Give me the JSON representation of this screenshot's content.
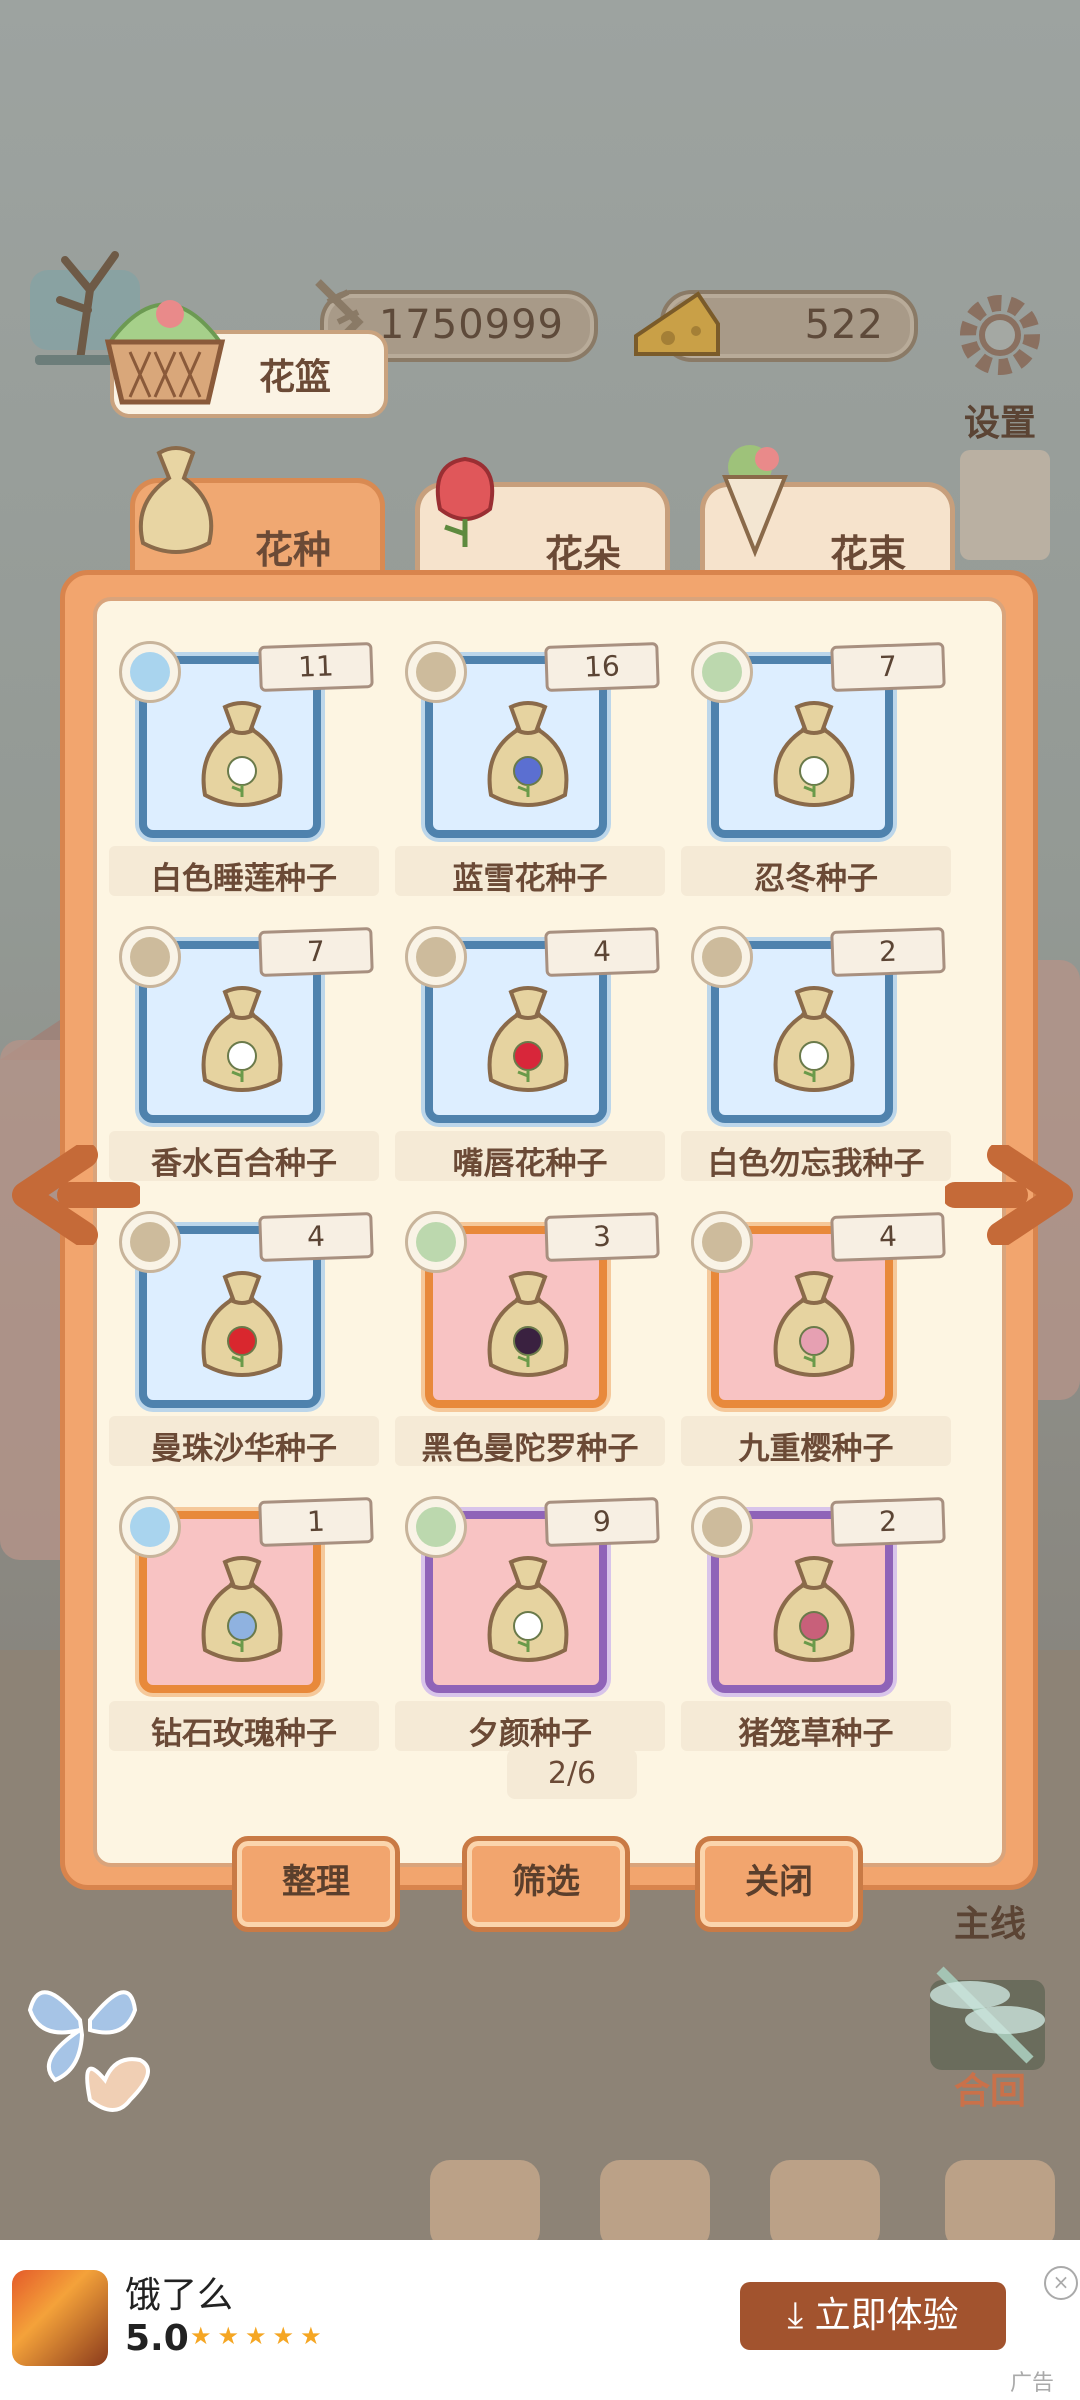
{
  "currency": {
    "coins": "1750999",
    "cheese": "522"
  },
  "side_buttons": {
    "settings": "设置",
    "mainline": "主线",
    "return": "合回"
  },
  "basket": {
    "label": "花篮"
  },
  "tabs": [
    {
      "label": "花种",
      "active": true
    },
    {
      "label": "花朵",
      "active": false
    },
    {
      "label": "花束",
      "active": false
    }
  ],
  "items": [
    {
      "name": "白色睡莲种子",
      "count": "11",
      "frame": "blue",
      "type": "water",
      "flower": "#ffffff"
    },
    {
      "name": "蓝雪花种子",
      "count": "16",
      "frame": "blue",
      "type": "soil",
      "flower": "#5b6fd1"
    },
    {
      "name": "忍冬种子",
      "count": "7",
      "frame": "blue",
      "type": "leaf",
      "flower": "#ffffff"
    },
    {
      "name": "香水百合种子",
      "count": "7",
      "frame": "blue",
      "type": "soil",
      "flower": "#ffffff"
    },
    {
      "name": "嘴唇花种子",
      "count": "4",
      "frame": "blue",
      "type": "soil",
      "flower": "#d8263a"
    },
    {
      "name": "白色勿忘我种子",
      "count": "2",
      "frame": "blue",
      "type": "soil",
      "flower": "#ffffff"
    },
    {
      "name": "曼珠沙华种子",
      "count": "4",
      "frame": "blue",
      "type": "soil",
      "flower": "#d9272e"
    },
    {
      "name": "黑色曼陀罗种子",
      "count": "3",
      "frame": "orange",
      "type": "leaf",
      "flower": "#3a2140"
    },
    {
      "name": "九重樱种子",
      "count": "4",
      "frame": "orange",
      "type": "soil",
      "flower": "#e6a0b2"
    },
    {
      "name": "钻石玫瑰种子",
      "count": "1",
      "frame": "orange",
      "type": "water",
      "flower": "#8fb2e0"
    },
    {
      "name": "夕颜种子",
      "count": "9",
      "frame": "purple",
      "type": "leaf",
      "flower": "#ffffff"
    },
    {
      "name": "猪笼草种子",
      "count": "2",
      "frame": "purple",
      "type": "soil",
      "flower": "#c8607a"
    }
  ],
  "pager": {
    "text": "2/6"
  },
  "buttons": {
    "sort": "整理",
    "filter": "筛选",
    "close": "关闭"
  },
  "ad": {
    "title": "饿了么",
    "rating": "5.0",
    "stars": "★★★★★",
    "cta": "立即体验",
    "cta_icon": "download-icon",
    "tag": "广告",
    "close": "×"
  },
  "colors": {
    "frame_blue": "#4f82ad",
    "frame_orange": "#e8893b",
    "frame_purple": "#8f63b8",
    "panel": "#f2a56e",
    "ad_button": "#a2532e"
  }
}
